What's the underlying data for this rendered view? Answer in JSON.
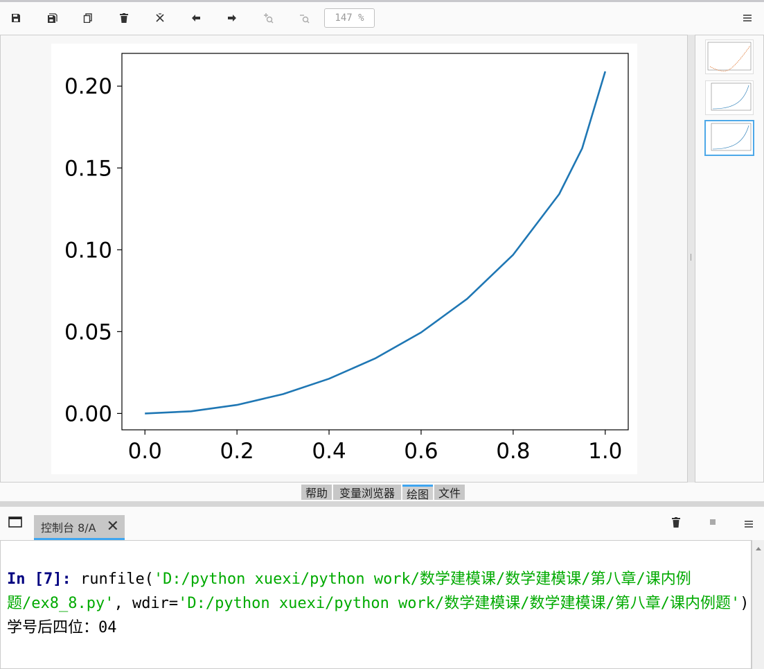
{
  "toolbar": {
    "zoom_value": "147 %",
    "icons": [
      "save-icon",
      "save-all-icon",
      "copy-icon",
      "trash-icon",
      "close-all-icon",
      "back-arrow-icon",
      "forward-arrow-icon",
      "zoom-in-icon",
      "zoom-out-icon",
      "menu-icon"
    ]
  },
  "pane_tabs": [
    {
      "label": "帮助"
    },
    {
      "label": "变量浏览器"
    },
    {
      "label": "绘图",
      "active": true
    },
    {
      "label": "文件"
    }
  ],
  "console": {
    "tab_label": "控制台 8/A",
    "prompt": "In [7]:",
    "command_fn": "runfile(",
    "arg1": "'D:/python xuexi/python work/数学建模课/数学建模课/第八章/课内例题/ex8_8.py'",
    "sep": ", wdir=",
    "arg2": "'D:/python xuexi/python work/数学建模课/数学建模课/第八章/课内例题'",
    "close_paren": ")",
    "output_label": "学号后四位：",
    "output_value": "04"
  },
  "chart_data": {
    "type": "line",
    "title": "",
    "xlabel": "",
    "ylabel": "",
    "xlim": [
      -0.05,
      1.05
    ],
    "ylim": [
      -0.01,
      0.22
    ],
    "xticks": [
      "0.0",
      "0.2",
      "0.4",
      "0.6",
      "0.8",
      "1.0"
    ],
    "yticks": [
      "0.00",
      "0.05",
      "0.10",
      "0.15",
      "0.20"
    ],
    "series": [
      {
        "color": "#1f77b4",
        "x": [
          0.0,
          0.1,
          0.2,
          0.3,
          0.4,
          0.5,
          0.6,
          0.7,
          0.8,
          0.9,
          0.95,
          1.0
        ],
        "y": [
          0.0,
          0.0013,
          0.0052,
          0.0118,
          0.0212,
          0.0336,
          0.0495,
          0.07,
          0.097,
          0.134,
          0.162,
          0.209
        ]
      }
    ]
  }
}
